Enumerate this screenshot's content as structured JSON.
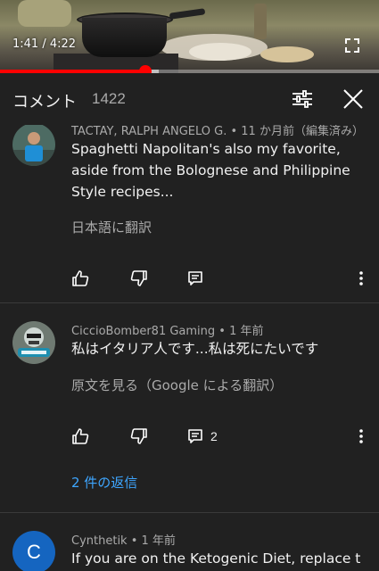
{
  "player": {
    "time_label": "1:41 / 4:22",
    "progress_fraction": 0.383,
    "buffered_fraction": 0.42,
    "fullscreen_icon": "fullscreen-icon"
  },
  "header": {
    "title": "コメント",
    "count": "1422",
    "filter_icon": "sort-filter-icon",
    "close_icon": "close-icon"
  },
  "comments": [
    {
      "author": "TACTAY, RALPH ANGELO G. • 11 か月前（編集済み）",
      "text": "Spaghetti Napolitan's also my favorite, aside from the Bolognese and Philippine Style recipes...",
      "translate_label": "日本語に翻訳",
      "reply_count": "",
      "avatar_colors": [
        "#2f6a86",
        "#1f7fbf"
      ]
    },
    {
      "author": "CiccioBomber81 Gaming • 1 年前",
      "text": "私はイタリア人です...私は死にたいです",
      "translate_label": "原文を見る（Google による翻訳）",
      "reply_count": "2",
      "replies_label": "2 件の返信",
      "avatar_colors": [
        "#5a6b66",
        "#1e8fb0"
      ]
    },
    {
      "author": "Cynthetik • 1 年前",
      "text": "If you are on the Ketogenic Diet, replace the",
      "avatar_letter": "C",
      "avatar_colors": [
        "#1565c0"
      ]
    }
  ],
  "colors": {
    "background": "#212121",
    "accent_red": "#ff0000",
    "link_blue": "#3ea6ff",
    "secondary_text": "#aaaaaa"
  }
}
